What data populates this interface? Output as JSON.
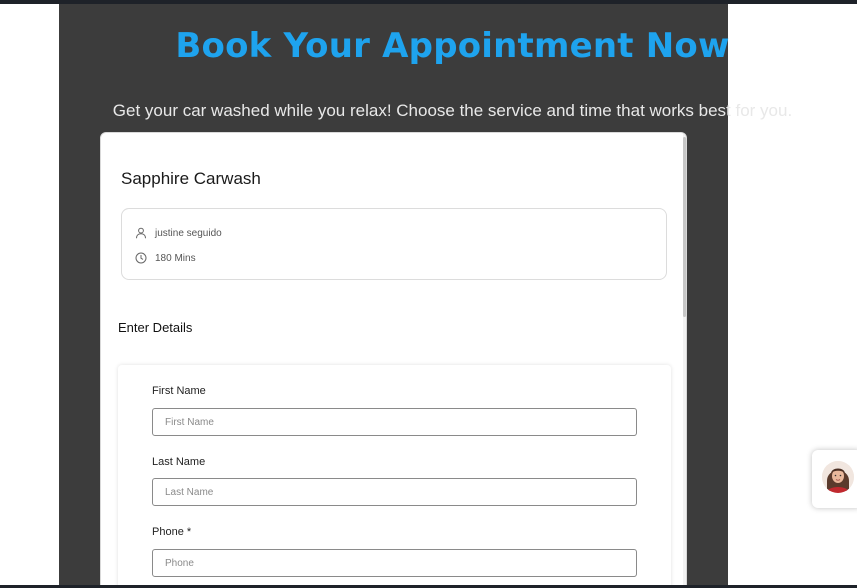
{
  "hero": {
    "title": "Book Your Appointment Now",
    "subtitle": "Get your car washed while you relax! Choose the service and time that works best for you."
  },
  "booking": {
    "business_name": "Sapphire Carwash",
    "host_icon": "user-icon",
    "host_name": "justine seguido",
    "duration_icon": "clock-icon",
    "duration": "180 Mins"
  },
  "form": {
    "section_title": "Enter Details",
    "fields": [
      {
        "label": "First Name",
        "placeholder": "First Name"
      },
      {
        "label": "Last Name",
        "placeholder": "Last Name"
      },
      {
        "label": "Phone *",
        "placeholder": "Phone"
      }
    ]
  },
  "chat_widget": {
    "icon": "agent-avatar"
  },
  "colors": {
    "accent": "#1ea3ee",
    "panel": "#3c3c3c"
  }
}
